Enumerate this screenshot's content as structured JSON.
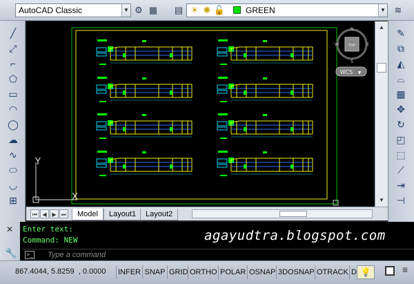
{
  "workspace": {
    "selected": "AutoCAD Classic"
  },
  "layer": {
    "selected": "GREEN",
    "color": "#00e000"
  },
  "viewcube": {
    "top_label": "TOP",
    "north": "N",
    "south": "S",
    "east": "E",
    "west": "W",
    "wcs_label": "WCS"
  },
  "ucs": {
    "y_label": "Y",
    "x_label": "X"
  },
  "tabs": {
    "model": "Model",
    "layout1": "Layout1",
    "layout2": "Layout2"
  },
  "command": {
    "history": [
      "Enter text:",
      "Command: NEW"
    ],
    "placeholder": "Type a command"
  },
  "watermark": "agayudtra.blogspot.com",
  "status": {
    "coordinates": "867.4044, 5.8259  , 0.0000",
    "toggles": [
      "INFER",
      "SNAP",
      "GRID",
      "ORTHO",
      "POLAR",
      "OSNAP",
      "3DOSNAP",
      "OTRACK",
      "D"
    ]
  },
  "colors": {
    "canvas": "#000000",
    "paper_border": "#00c000",
    "frame": "#f2f200",
    "title_green": "#00ff00",
    "cyan": "#00d8ff",
    "blue_text": "#2c6bff"
  },
  "icons": {
    "top": [
      "gear-icon",
      "workspace-icon",
      "layer-properties-icon",
      "lightbulb-icon",
      "sun-icon",
      "lock-icon",
      "layer-color-icon",
      "match-properties-icon"
    ],
    "left": [
      "line-icon",
      "construction-line-icon",
      "polyline-icon",
      "polygon-icon",
      "rectangle-icon",
      "arc-icon",
      "circle-icon",
      "revision-cloud-icon",
      "spline-icon",
      "ellipse-icon",
      "ellipse-arc-icon",
      "insert-block-icon"
    ],
    "right": [
      "erase-icon",
      "copy-icon",
      "mirror-icon",
      "offset-icon",
      "array-icon",
      "move-icon",
      "rotate-icon",
      "scale-icon",
      "stretch-icon",
      "trim-icon",
      "extend-icon",
      "break-icon"
    ]
  }
}
